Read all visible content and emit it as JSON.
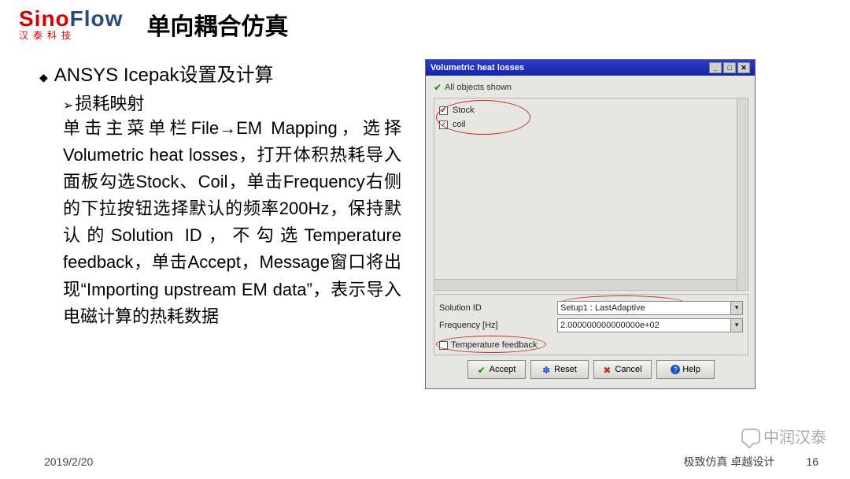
{
  "logo": {
    "s": "Sino",
    "f": "Flow",
    "sub": "汉泰科技"
  },
  "title": "单向耦合仿真",
  "bullet1": "ANSYS Icepak设置及计算",
  "bullet2": "损耗映射",
  "para": "单击主菜单栏File→EM Mapping，选择Volumetric heat losses，打开体积热耗导入面板勾选Stock、Coil，单击Frequency右侧的下拉按钮选择默认的频率200Hz，保持默认的Solution ID，不勾选Temperature feedback，单击Accept，Message窗口将出现“Importing upstream EM data”，表示导入电磁计算的热耗数据",
  "dialog": {
    "title": "Volumetric heat losses",
    "status": "All objects shown",
    "list": [
      {
        "checked": true,
        "label": "Stock"
      },
      {
        "checked": true,
        "label": "coil"
      }
    ],
    "solution_id_label": "Solution ID",
    "solution_id_value": "Setup1 : LastAdaptive",
    "frequency_label": "Frequency [Hz]",
    "frequency_value": "2.000000000000000e+02",
    "temperature_feedback_label": "Temperature feedback",
    "temperature_feedback_checked": false,
    "buttons": {
      "accept": "Accept",
      "reset": "Reset",
      "cancel": "Cancel",
      "help": "Help"
    }
  },
  "footer": {
    "date": "2019/2/20",
    "slogan": "极致仿真 卓越设计",
    "page": "16"
  },
  "watermark": "中润汉泰"
}
